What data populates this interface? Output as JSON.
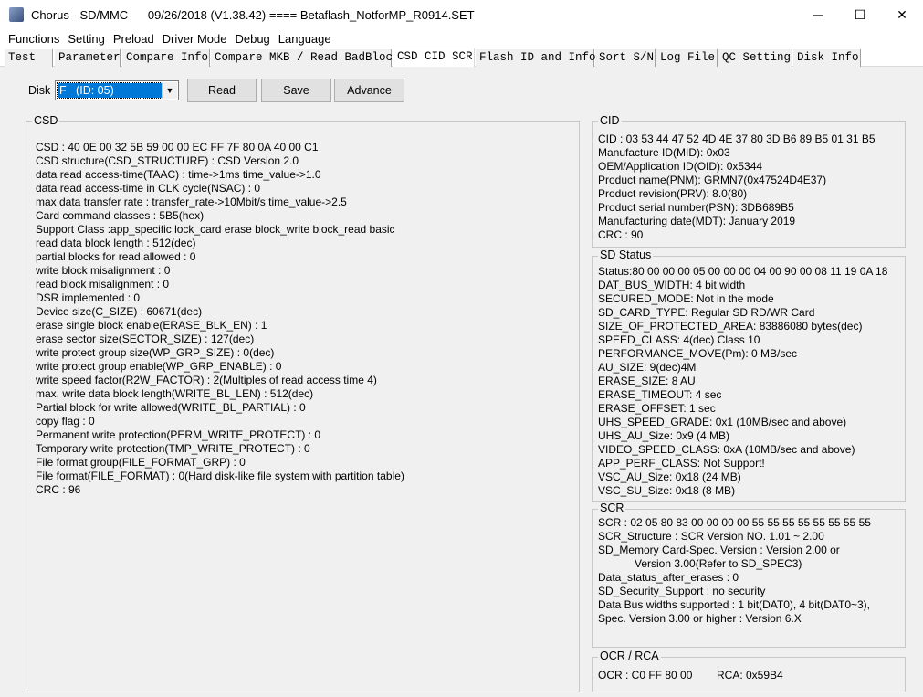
{
  "window": {
    "title": "Chorus - SD/MMC      09/26/2018 (V1.38.42) ==== Betaflash_NotforMP_R0914.SET",
    "minimize": "─",
    "maximize": "☐",
    "close": "✕"
  },
  "menu": [
    "Functions",
    "Setting",
    "Preload",
    "Driver Mode",
    "Debug",
    "Language"
  ],
  "tabs": [
    "Test",
    "Parameter",
    "Compare Info",
    "Compare MKB / Read BadBlock",
    "CSD CID SCR",
    "Flash ID and Info",
    "Sort S/N",
    "Log File",
    "QC Setting",
    "Disk Info"
  ],
  "active_tab": "CSD CID SCR",
  "toolbar": {
    "disk_label": "Disk",
    "disk_value": "F   (ID: 05)",
    "read": "Read",
    "save": "Save",
    "advance": "Advance"
  },
  "csd": {
    "title": "CSD",
    "lines": [
      "CSD : 40 0E 00 32 5B 59 00 00 EC FF 7F 80 0A 40 00 C1",
      "CSD structure(CSD_STRUCTURE) : CSD Version 2.0",
      "data read access-time(TAAC) : time->1ms time_value->1.0",
      "data read access-time in CLK cycle(NSAC) : 0",
      "max data transfer rate : transfer_rate->10Mbit/s time_value->2.5",
      "Card command classes : 5B5(hex)",
      "Support Class :app_specific lock_card erase block_write block_read basic",
      "read data block length : 512(dec)",
      "partial blocks for read allowed : 0",
      "write block misalignment : 0",
      "read block misalignment : 0",
      "DSR implemented : 0",
      "Device size(C_SIZE) : 60671(dec)",
      "erase single block enable(ERASE_BLK_EN) : 1",
      "erase sector size(SECTOR_SIZE) : 127(dec)",
      "write protect group size(WP_GRP_SIZE) : 0(dec)",
      "write protect group enable(WP_GRP_ENABLE) : 0",
      "write speed factor(R2W_FACTOR) : 2(Multiples of read access time 4)",
      "max. write data block length(WRITE_BL_LEN) : 512(dec)",
      "Partial block for write allowed(WRITE_BL_PARTIAL) : 0",
      "copy flag : 0",
      "Permanent write protection(PERM_WRITE_PROTECT) : 0",
      "Temporary write protection(TMP_WRITE_PROTECT) : 0",
      "File format group(FILE_FORMAT_GRP) : 0",
      "File format(FILE_FORMAT) : 0(Hard disk-like file system with partition table)",
      "CRC : 96"
    ]
  },
  "cid": {
    "title": "CID",
    "lines": [
      "CID : 03 53 44 47 52 4D 4E 37 80 3D B6 89 B5 01 31 B5",
      "Manufacture ID(MID): 0x03",
      "OEM/Application ID(OID): 0x5344",
      "Product name(PNM): GRMN7(0x47524D4E37)",
      "Product revision(PRV): 8.0(80)",
      "Product serial number(PSN): 3DB689B5",
      "Manufacturing date(MDT): January 2019",
      "CRC : 90"
    ]
  },
  "sd_status": {
    "title": "SD Status",
    "lines": [
      "Status:80 00 00 00 05 00 00 00 04 00 90 00 08 11 19 0A 18",
      "DAT_BUS_WIDTH: 4 bit width",
      "SECURED_MODE: Not in the mode",
      "SD_CARD_TYPE: Regular SD RD/WR Card",
      "SIZE_OF_PROTECTED_AREA: 83886080 bytes(dec)",
      "SPEED_CLASS: 4(dec) Class 10",
      "PERFORMANCE_MOVE(Pm): 0 MB/sec",
      "AU_SIZE: 9(dec)4M",
      "ERASE_SIZE: 8 AU",
      "ERASE_TIMEOUT: 4 sec",
      "ERASE_OFFSET: 1 sec",
      "UHS_SPEED_GRADE: 0x1 (10MB/sec and above)",
      "UHS_AU_Size: 0x9 (4 MB)",
      "VIDEO_SPEED_CLASS: 0xA (10MB/sec and above)",
      "APP_PERF_CLASS: Not Support!",
      "VSC_AU_Size: 0x18 (24 MB)",
      "VSC_SU_Size: 0x18 (8 MB)"
    ]
  },
  "scr": {
    "title": "SCR",
    "lines": [
      "SCR : 02 05 80 83 00 00 00 00 55 55 55 55 55 55 55 55",
      "SCR_Structure : SCR Version NO. 1.01 ~ 2.00",
      "SD_Memory Card-Spec. Version : Version 2.00 or",
      "Version 3.00(Refer to SD_SPEC3)",
      "Data_status_after_erases : 0",
      "SD_Security_Support : no security",
      "Data Bus widths supported : 1 bit(DAT0), 4 bit(DAT0~3),",
      "Spec. Version 3.00 or higher : Version 6.X"
    ]
  },
  "ocr_rca": {
    "title": "OCR / RCA",
    "ocr": "OCR : C0 FF 80 00",
    "rca": "RCA: 0x59B4"
  }
}
